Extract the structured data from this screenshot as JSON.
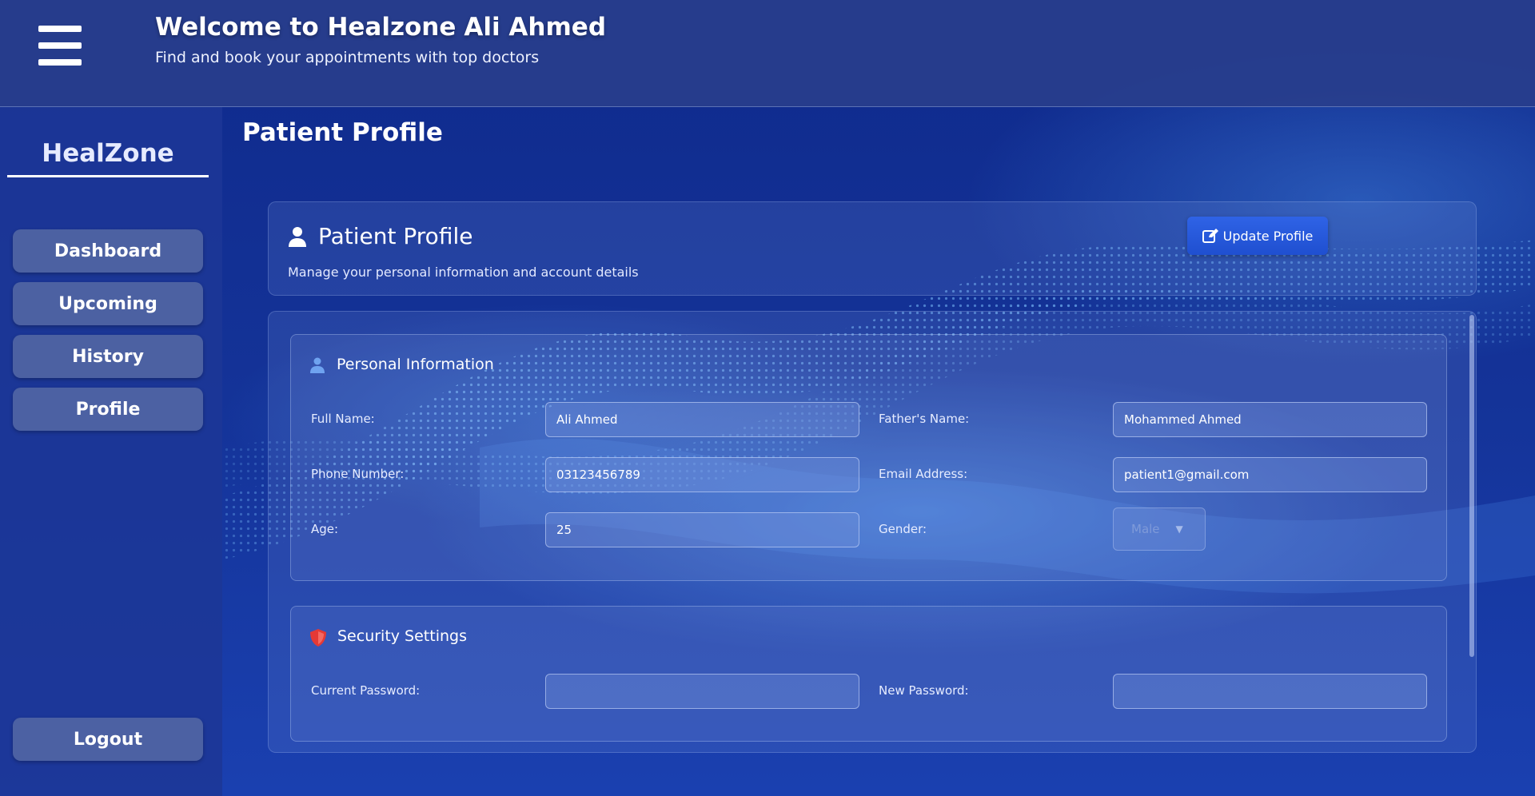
{
  "header": {
    "menu_icon": "hamburger-menu-icon",
    "title_prefix": "Welcome to Healzone",
    "user_name": "Ali Ahmed",
    "subtitle": "Find and book your appointments with top doctors"
  },
  "sidebar": {
    "brand": "HealZone",
    "items": [
      {
        "label": "Dashboard"
      },
      {
        "label": "Upcoming"
      },
      {
        "label": "History"
      },
      {
        "label": "Profile"
      }
    ],
    "logout_label": "Logout"
  },
  "main": {
    "page_title": "Patient Profile",
    "profile_header": {
      "icon": "user-icon",
      "title": "Patient Profile",
      "description": "Manage your personal information and account details",
      "update_button": {
        "icon": "edit-icon",
        "label": "Update Profile"
      }
    },
    "personal_information": {
      "icon": "user-icon",
      "title": "Personal Information",
      "fields": {
        "full_name": {
          "label": "Full Name:",
          "value": "Ali Ahmed"
        },
        "fathers_name": {
          "label": "Father's Name:",
          "value": "Mohammed Ahmed"
        },
        "phone_number": {
          "label": "Phone Number:",
          "value": "03123456789"
        },
        "email_address": {
          "label": "Email Address:",
          "value": "patient1@gmail.com"
        },
        "age": {
          "label": "Age:",
          "value": "25"
        },
        "gender": {
          "label": "Gender:",
          "value": "Male"
        }
      }
    },
    "security_settings": {
      "icon": "shield-icon",
      "title": "Security Settings",
      "fields": {
        "current_password": {
          "label": "Current Password:",
          "value": ""
        },
        "new_password": {
          "label": "New Password:",
          "value": ""
        }
      }
    }
  },
  "colors": {
    "header_bg": "#2a3e8c",
    "sidebar_bg": "#1c3796",
    "nav_button_bg": "#5569a5",
    "accent_button": "#2a5ce0",
    "shield_icon": "#e53935",
    "user_icon_accent": "#6fa3f0"
  }
}
